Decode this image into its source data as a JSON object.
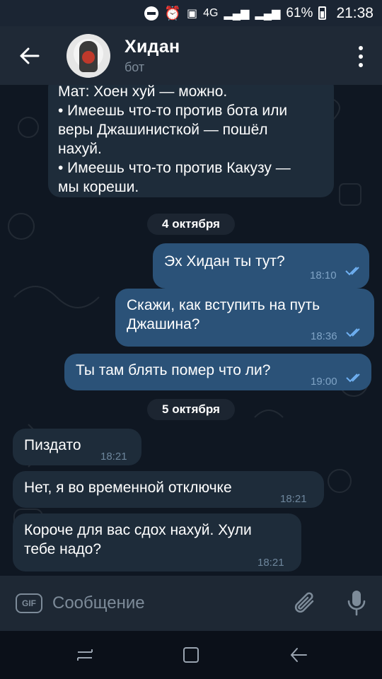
{
  "status_bar": {
    "network": "4G",
    "battery": "61%",
    "time": "21:38"
  },
  "header": {
    "title": "Хидан",
    "subtitle": "бот",
    "icons": [
      "back-arrow-icon",
      "avatar",
      "more-vert-icon"
    ]
  },
  "chat": {
    "partial_message": {
      "cut_line": "Мат: Хоен хуй — можно.",
      "lines": [
        "• Имеешь что-то против бота или",
        "веры Джашинисткой — пошёл",
        "нахуй.",
        "• Имеешь что-то против Какузу —",
        "мы кореши."
      ]
    },
    "dates": [
      "4 октября",
      "5 октября"
    ],
    "messages": [
      {
        "dir": "out",
        "text": "Эх Хидан ты тут?",
        "time": "18:10"
      },
      {
        "dir": "out",
        "text": "Скажи, как вступить на путь Джашина?",
        "lines": [
          "Скажи, как вступить на путь",
          "Джашина?"
        ],
        "time": "18:36"
      },
      {
        "dir": "out",
        "text": "Ты там блять помер что ли?",
        "time": "19:00"
      },
      {
        "dir": "in",
        "text": "Пиздато",
        "time": "18:21"
      },
      {
        "dir": "in",
        "text": "Нет, я во временной отключке",
        "time": "18:21"
      },
      {
        "dir": "in",
        "text": "Короче для вас сдох нахуй. Хули тебе надо?",
        "lines": [
          "Короче для вас сдох нахуй. Хули",
          "тебе надо?"
        ],
        "time": "18:21"
      }
    ]
  },
  "composer": {
    "gif_label": "GIF",
    "placeholder": "Сообщение",
    "icons": [
      "gif-icon",
      "attach-icon",
      "mic-icon"
    ]
  },
  "colors": {
    "background": "#0e1621",
    "header": "#1f2936",
    "incoming_bubble": "#1e2c3a",
    "outgoing_bubble": "#2b5278",
    "read_ticks": "#6fb0f2"
  }
}
